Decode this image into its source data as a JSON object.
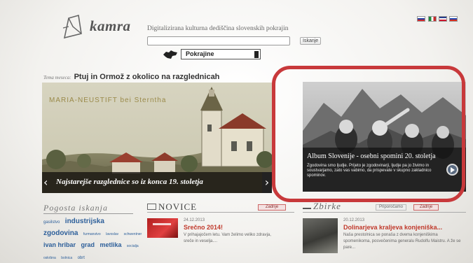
{
  "header": {
    "logo_text": "kamra",
    "tagline": "Digitalizirana kulturna dediščina slovenskih pokrajin",
    "search": {
      "value": "",
      "placeholder": "",
      "button_label": "Iskanje"
    },
    "region_select": {
      "selected": "Pokrajine"
    }
  },
  "languages": [
    {
      "name": "slovenian-flag",
      "colors": [
        "#ffffff",
        "#1f3f9f",
        "#d0262e"
      ]
    },
    {
      "name": "italian-flag",
      "colors": [
        "#1e8a3a",
        "#ffffff",
        "#c62b2b"
      ]
    },
    {
      "name": "english-flag",
      "colors": [
        "#2a3f8c",
        "#ffffff",
        "#cf142b"
      ]
    },
    {
      "name": "russian-flag",
      "colors": [
        "#ffffff",
        "#1f46b3",
        "#d52b1e"
      ]
    }
  ],
  "theme": {
    "label": "Tema meseca:",
    "title": "Ptuj in Ormož z okolico na razglednicah"
  },
  "slider": {
    "postcard_heading": "MARIA-NEUSTIFT bei Sterntha",
    "caption": "Najstarejše razglednice so iz konca 19. stoletja",
    "prev_icon": "‹",
    "next_icon": "›"
  },
  "album": {
    "title": "Album Slovenije - osebni spomini 20. stoletja",
    "description": "Zgodovina smo ljudje. Prijeto je zgodovinarji, ljudje pa jo živimo in soustvarjamo, zato vas vabimo, da prispevate v skupno zakladnico spominov."
  },
  "search_section": {
    "heading": "Pogosta iskanja",
    "tags": [
      {
        "text": "gasilstvo",
        "size": 6
      },
      {
        "text": "industrijska",
        "size": 10
      },
      {
        "text": "zgodovina",
        "size": 10
      },
      {
        "text": "furmanstvo",
        "size": 5
      },
      {
        "text": "lavoslav",
        "size": 5
      },
      {
        "text": "schwentner",
        "size": 5
      },
      {
        "text": "ivan hribar",
        "size": 9
      },
      {
        "text": "grad",
        "size": 9
      },
      {
        "text": "metlika",
        "size": 9
      },
      {
        "text": "socialja",
        "size": 5
      },
      {
        "text": "oskrbna",
        "size": 5
      },
      {
        "text": "bolnica",
        "size": 5
      },
      {
        "text": "obrt",
        "size": 6
      }
    ]
  },
  "news": {
    "heading": "NOVICE",
    "button_label": "Zadnje",
    "item": {
      "date": "24.12.2013",
      "title": "Srečno 2014!",
      "text": "V prihajajočem letu. Vam želimo veliko zdravja, sreče in veselja...."
    }
  },
  "collections": {
    "heading": "Zbirke",
    "buttons": [
      "Priporočamo",
      "Zadnje"
    ],
    "item": {
      "date": "20.12.2013",
      "title": "Dolinarjeva kraljeva konjeniška...",
      "text": "Naša prestolnica se ponaša z dvema konjeniškima spomenikoma, posvečenima generalu Rudolfu Maistru. A že se pare..."
    }
  },
  "colors": {
    "accent_red": "#c0392b",
    "highlight": "#c8393b",
    "link_blue": "#2d5f9a"
  }
}
